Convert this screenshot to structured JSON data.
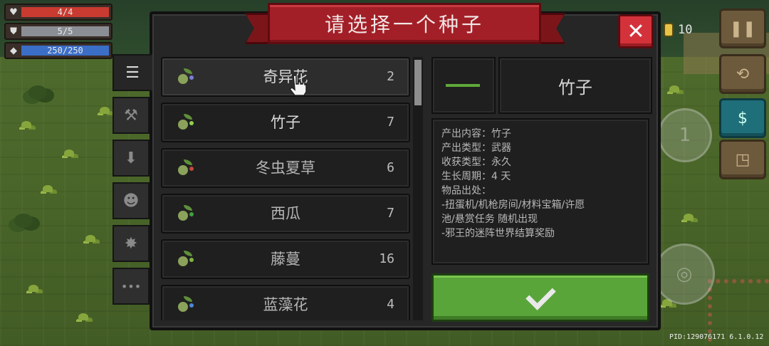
{
  "hud": {
    "hp": "4/4",
    "shield": "5/5",
    "energy": "250/250",
    "coins": "10"
  },
  "dialog": {
    "title": "请选择一个种子",
    "close_glyph": "✕"
  },
  "tabs": [
    {
      "icon": "list-icon",
      "glyph": "☰",
      "active": true
    },
    {
      "icon": "weapon-icon",
      "glyph": "⚒",
      "active": false
    },
    {
      "icon": "down-arrow-icon",
      "glyph": "⬇",
      "active": false
    },
    {
      "icon": "pet-icon",
      "glyph": "☻",
      "active": false
    },
    {
      "icon": "burst-icon",
      "glyph": "✸",
      "active": false
    },
    {
      "icon": "more-icon",
      "glyph": "•••",
      "active": false
    }
  ],
  "seeds": [
    {
      "name": "奇异花",
      "count": "2",
      "accent": "#7d7fd6"
    },
    {
      "name": "竹子",
      "count": "7",
      "accent": "#8fd14f"
    },
    {
      "name": "冬虫夏草",
      "count": "6",
      "accent": "#c24a3a"
    },
    {
      "name": "西瓜",
      "count": "7",
      "accent": "#3f9f40"
    },
    {
      "name": "藤蔓",
      "count": "16",
      "accent": "#7fb640"
    },
    {
      "name": "蓝藻花",
      "count": "4",
      "accent": "#4e86d6"
    }
  ],
  "selected": {
    "name": "竹子",
    "info_lines": [
      "产出内容：竹子",
      "产出类型：武器",
      "收获类型：永久",
      "生长周期：4 天",
      "物品出处：",
      "-扭蛋机/机枪房间/材料宝箱/许愿",
      "池/悬赏任务 随机出现",
      "-邪王的迷阵世界结算奖励"
    ]
  },
  "right_hud": {
    "joystick_label": "1"
  },
  "footer": {
    "pid": "PID:129076171 6.1.0.12"
  }
}
